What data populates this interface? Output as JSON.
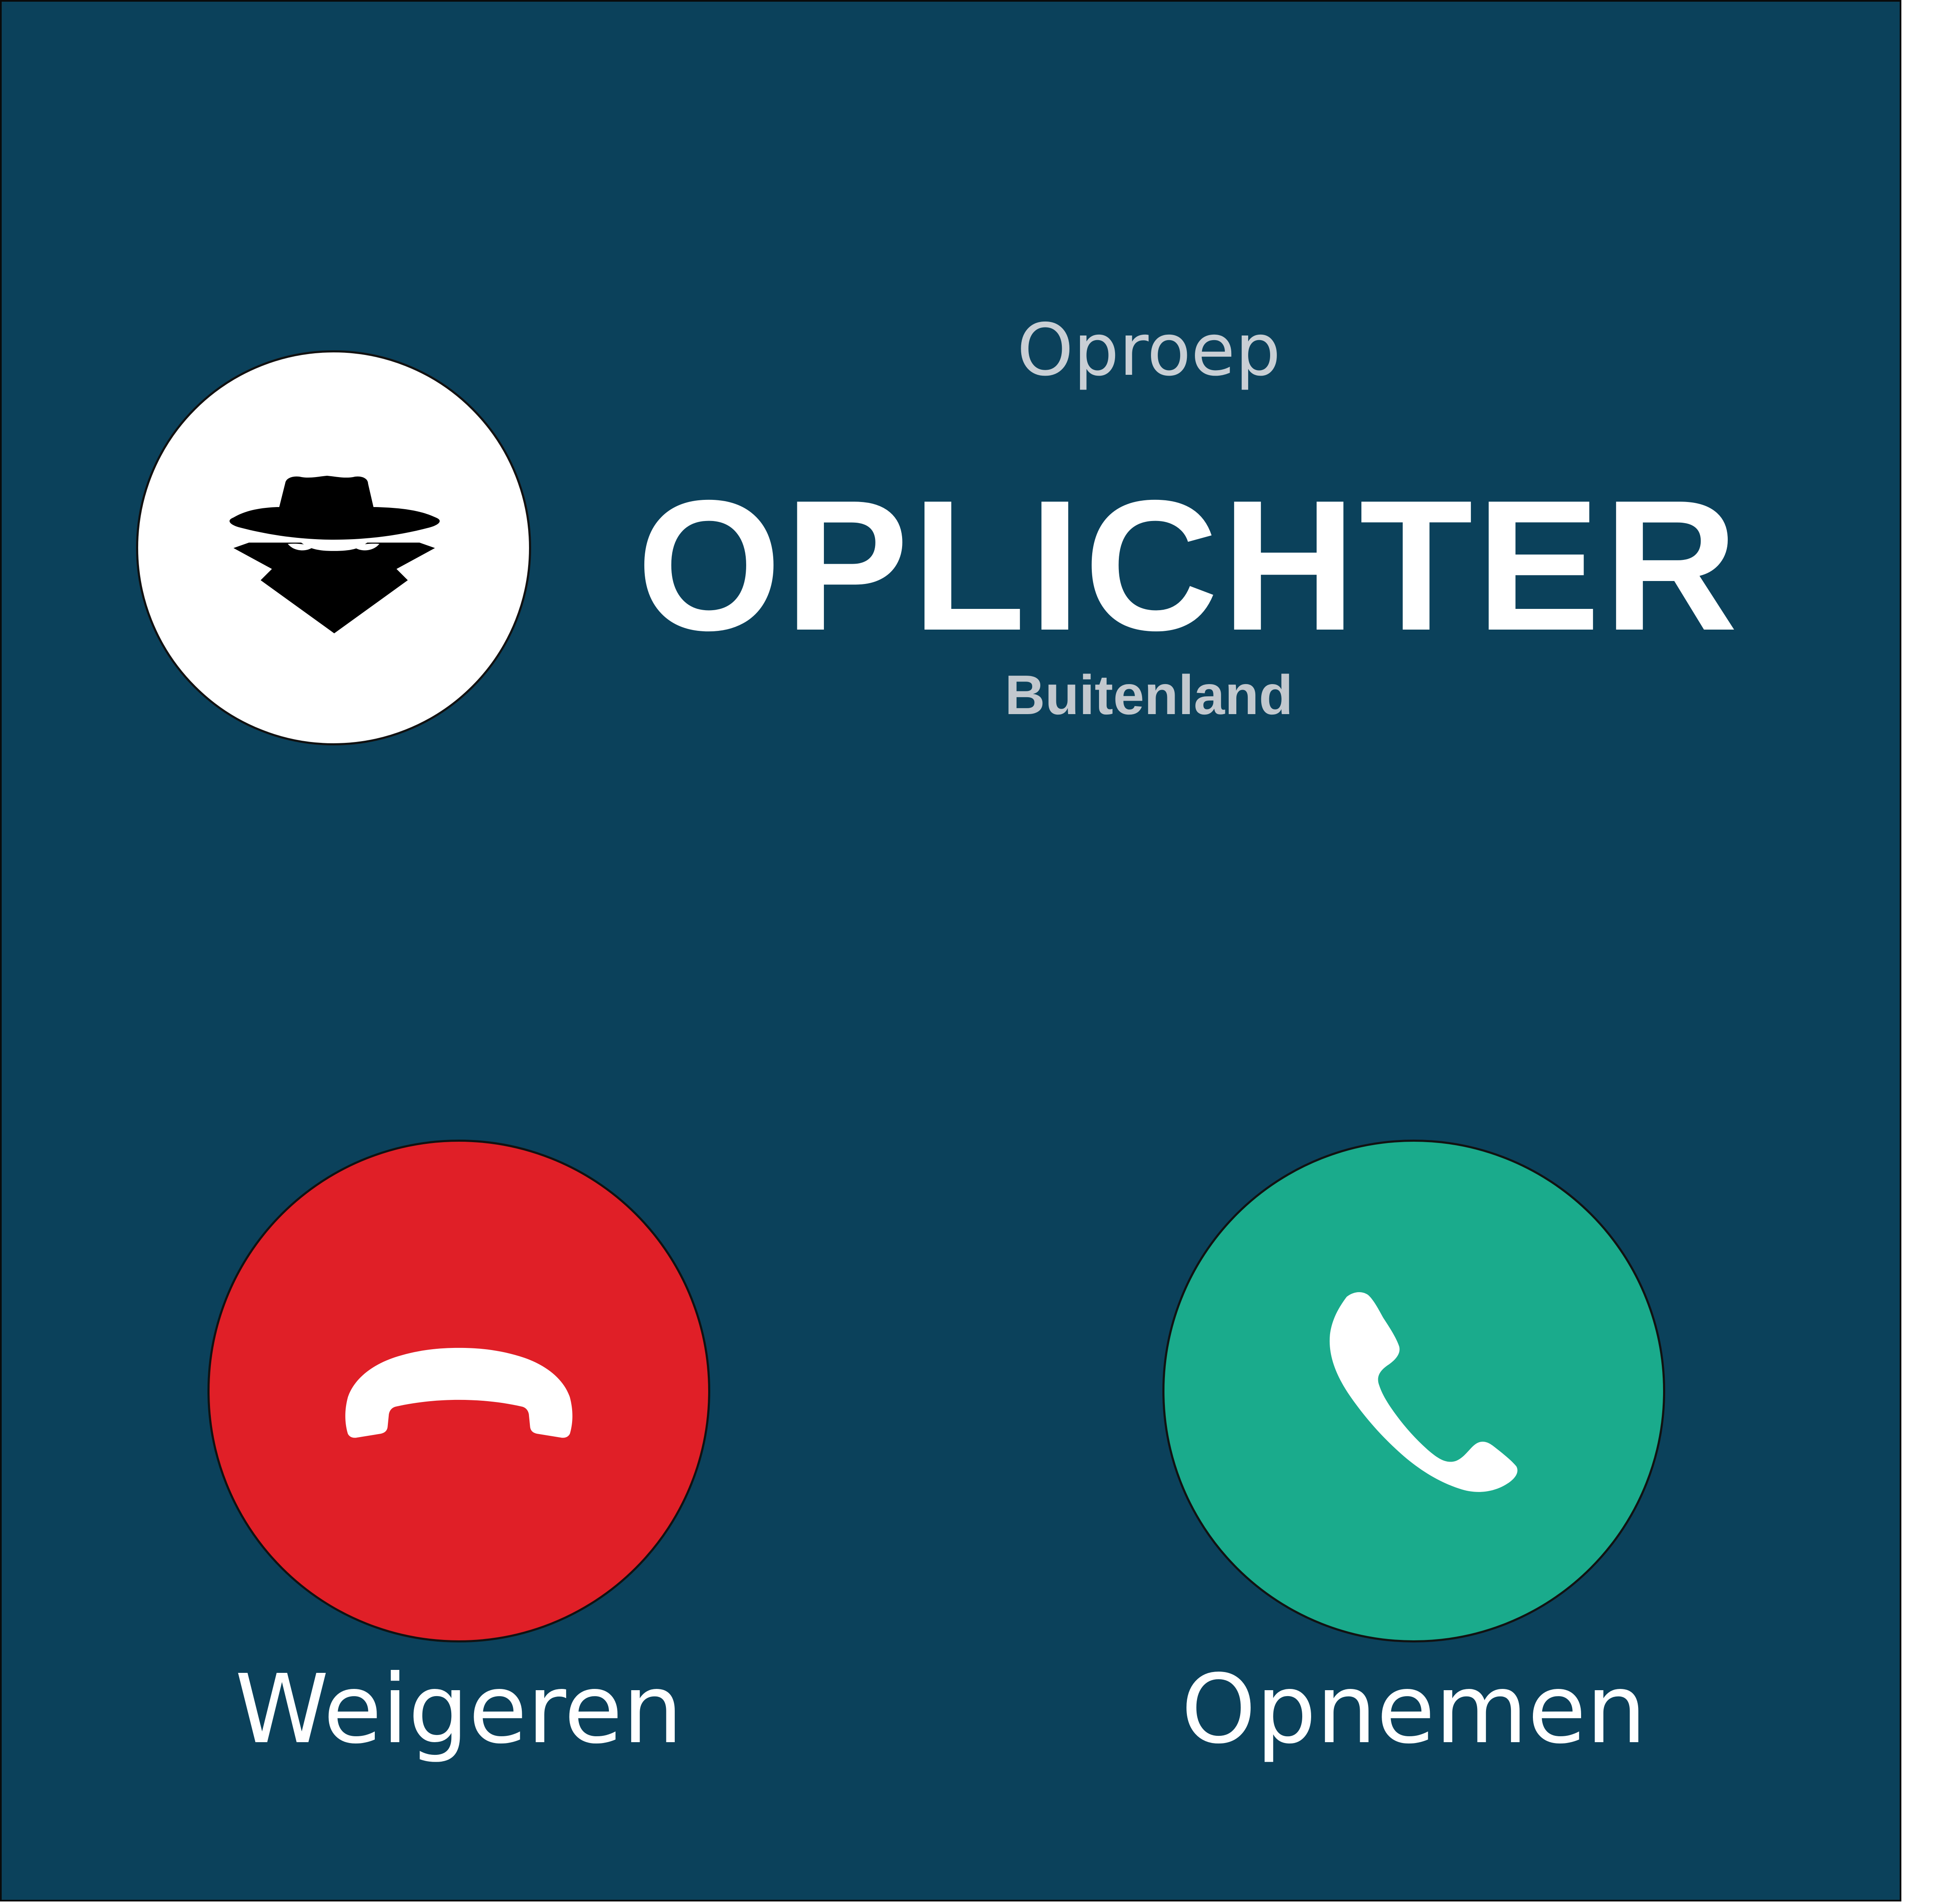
{
  "call": {
    "label": "Oproep",
    "caller_name": "OPLICHTER",
    "caller_location": "Buitenland",
    "avatar_icon": "spy-icon"
  },
  "actions": {
    "decline": {
      "label": "Weigeren",
      "icon": "hang-up-phone-icon",
      "color": "#e01f27"
    },
    "accept": {
      "label": "Opnemen",
      "icon": "phone-icon",
      "color": "#1aab8c"
    }
  },
  "colors": {
    "background": "#0b415b",
    "avatar_background": "#ffffff",
    "text": "#ffffff",
    "muted_text": "#c9cfd5"
  }
}
